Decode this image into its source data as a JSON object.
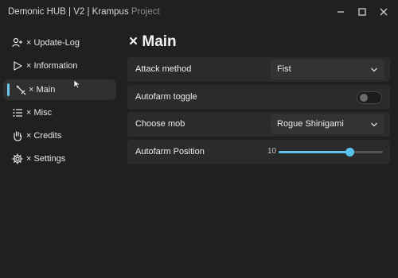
{
  "window": {
    "title": "Demonic HUB | V2 | Krampus",
    "subtitle": "Project"
  },
  "sidebar": {
    "items": [
      {
        "label": "× Update-Log",
        "icon": "user-add-icon",
        "active": false
      },
      {
        "label": "× Information",
        "icon": "play-icon",
        "active": false
      },
      {
        "label": "× Main",
        "icon": "sword-icon",
        "active": true
      },
      {
        "label": "× Misc",
        "icon": "list-icon",
        "active": false
      },
      {
        "label": "× Credits",
        "icon": "hand-icon",
        "active": false
      },
      {
        "label": "× Settings",
        "icon": "gear-icon",
        "active": false
      }
    ]
  },
  "main": {
    "title": "× Main",
    "attack_method": {
      "label": "Attack method",
      "value": "Fist"
    },
    "autofarm_toggle": {
      "label": "Autofarm toggle",
      "enabled": false
    },
    "choose_mob": {
      "label": "Choose mob",
      "value": "Rogue Shinigami"
    },
    "autofarm_position": {
      "label": "Autofarm Position",
      "value": "10",
      "fraction": 0.68
    }
  },
  "background": {
    "labels": [
      "n_Quest",
      "ws"
    ]
  },
  "colors": {
    "accent": "#5bc3ef",
    "window_bg": "#212121",
    "row_bg": "#2b2b2b"
  }
}
